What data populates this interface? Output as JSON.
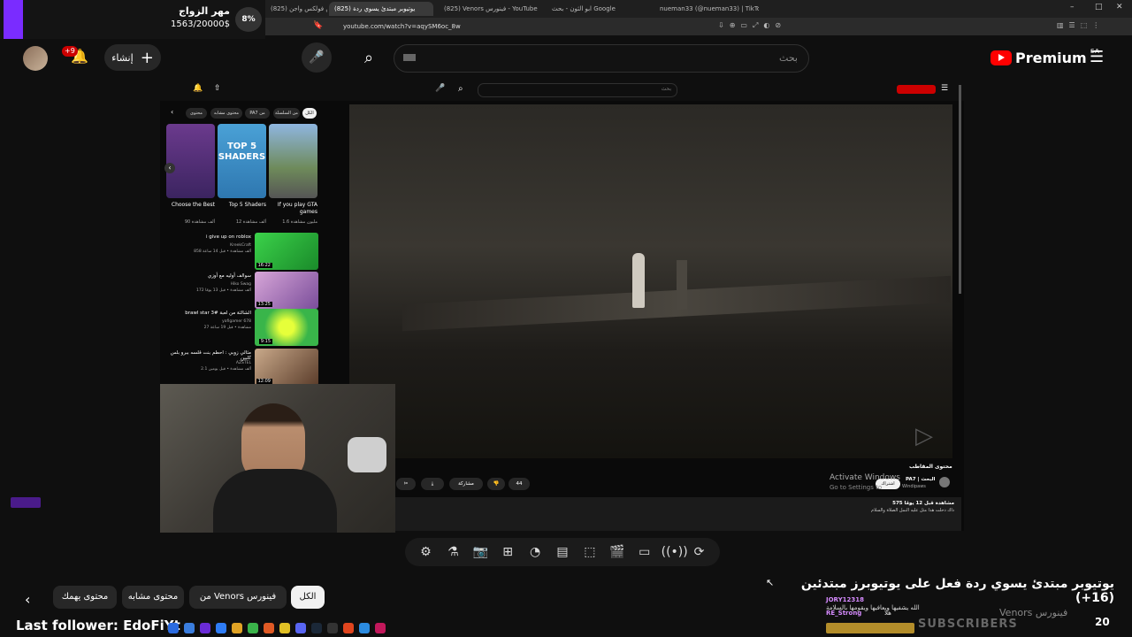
{
  "browser": {
    "tabs": [
      {
        "label": "(825) عروض فولكس واجن",
        "active": false
      },
      {
        "label": "(825) يوتيوبر مبتدئ يسوي ردة",
        "active": true
      },
      {
        "label": "(825) Venors فينورس - YouTube",
        "active": false
      },
      {
        "label": "ابو الثون - بحث Google",
        "active": false
      },
      {
        "label": "nueman33 (@nueman33) | TikTok",
        "active": false
      }
    ],
    "url": "youtube.com/watch?v=aqySM6oc_8w"
  },
  "donation_goal": {
    "title": "مهر الزواج",
    "amount": "1563/20000$",
    "percent": "8%",
    "accent_color": "#7a2cff"
  },
  "youtube_header": {
    "create_label": "إنشاء",
    "notification_badge": "+9",
    "search_placeholder": "بحث",
    "logo_text": "Premium",
    "region": "SA"
  },
  "inner_page": {
    "filter_chips": [
      "الكل",
      "من السلسلة",
      "PA7 من",
      "محتوى مشابه",
      "محتوى"
    ],
    "shorts": [
      {
        "title": "If you play GTA games",
        "meta": "1.6 مليون مشاهدة",
        "thumb_text": ""
      },
      {
        "title": "Top 5 Shaders",
        "meta": "12 ألف مشاهدة",
        "thumb_text": "TOP 5 SHADERS"
      },
      {
        "title": "Choose the Best",
        "meta": "90 ألف مشاهدة",
        "thumb_text": ""
      }
    ],
    "related": [
      {
        "title": "i give up on roblox",
        "channel": "KreekCraft",
        "meta": "858 ألف مشاهدة • قبل 14 ساعة",
        "duration": "16:22"
      },
      {
        "title": "سوالف أوليه مع أوزي",
        "channel": "Hiko Swag",
        "meta": "172 ألف مشاهدة • قبل 13 يومًا",
        "duration": "13:25"
      },
      {
        "title": "brawl star 3# الشالثة من لعبة",
        "channel": "yafigamer 678",
        "meta": "27 مشاهدة • قبل 19 ساعة",
        "duration": "9:15"
      },
      {
        "title": "مثالي زوبي : احطم بنت قلسه ببرو بلس كلبين",
        "channel": "AZSTEL",
        "meta": "2.1 ألف مشاهدة • قبل يومين",
        "duration": "12:09"
      }
    ],
    "channel": {
      "name": "PA7 | البحث",
      "subs": "Windipaws",
      "subscribe": "اشتراك",
      "section": "محتوى المقاطب"
    },
    "actions": {
      "likes": "44",
      "share": "مشاركة"
    },
    "description": {
      "views": "575 مشاهدة قبل 12 يومًا",
      "line1": "ذاك دحلت هذا مثل عليه النمل الصلاة والسلام"
    },
    "watermark": {
      "line1": "Activate Windows",
      "line2": "Go to Settings to"
    }
  },
  "toolbar": {
    "icons": [
      "gear-icon",
      "flask-icon",
      "camera-icon",
      "add-icon",
      "speed-icon",
      "subtitles-icon",
      "aspect-icon",
      "clip-icon",
      "screen-icon",
      "broadcast-icon",
      "loop-icon"
    ]
  },
  "bottom_chips": [
    "الكل",
    "من Venors فينورس",
    "محتوى مشابه",
    "محتوى يهمك"
  ],
  "video_title": "يوتيوبر مبتدئ يسوي ردة فعل على يوتيوبرز مبتدئين (16+)",
  "chat": [
    {
      "user": "JORY12318",
      "msg": "الله يشفيها ويعافيها ويقومها بالسلامة"
    },
    {
      "user": "RE_Strong",
      "msg": "هلا"
    }
  ],
  "channel_overlay": "Venors فينورس",
  "subscribers_banner": "SUBSCRIBERS",
  "counter": "20",
  "last_follower": "Last follower: EdoFiYt"
}
